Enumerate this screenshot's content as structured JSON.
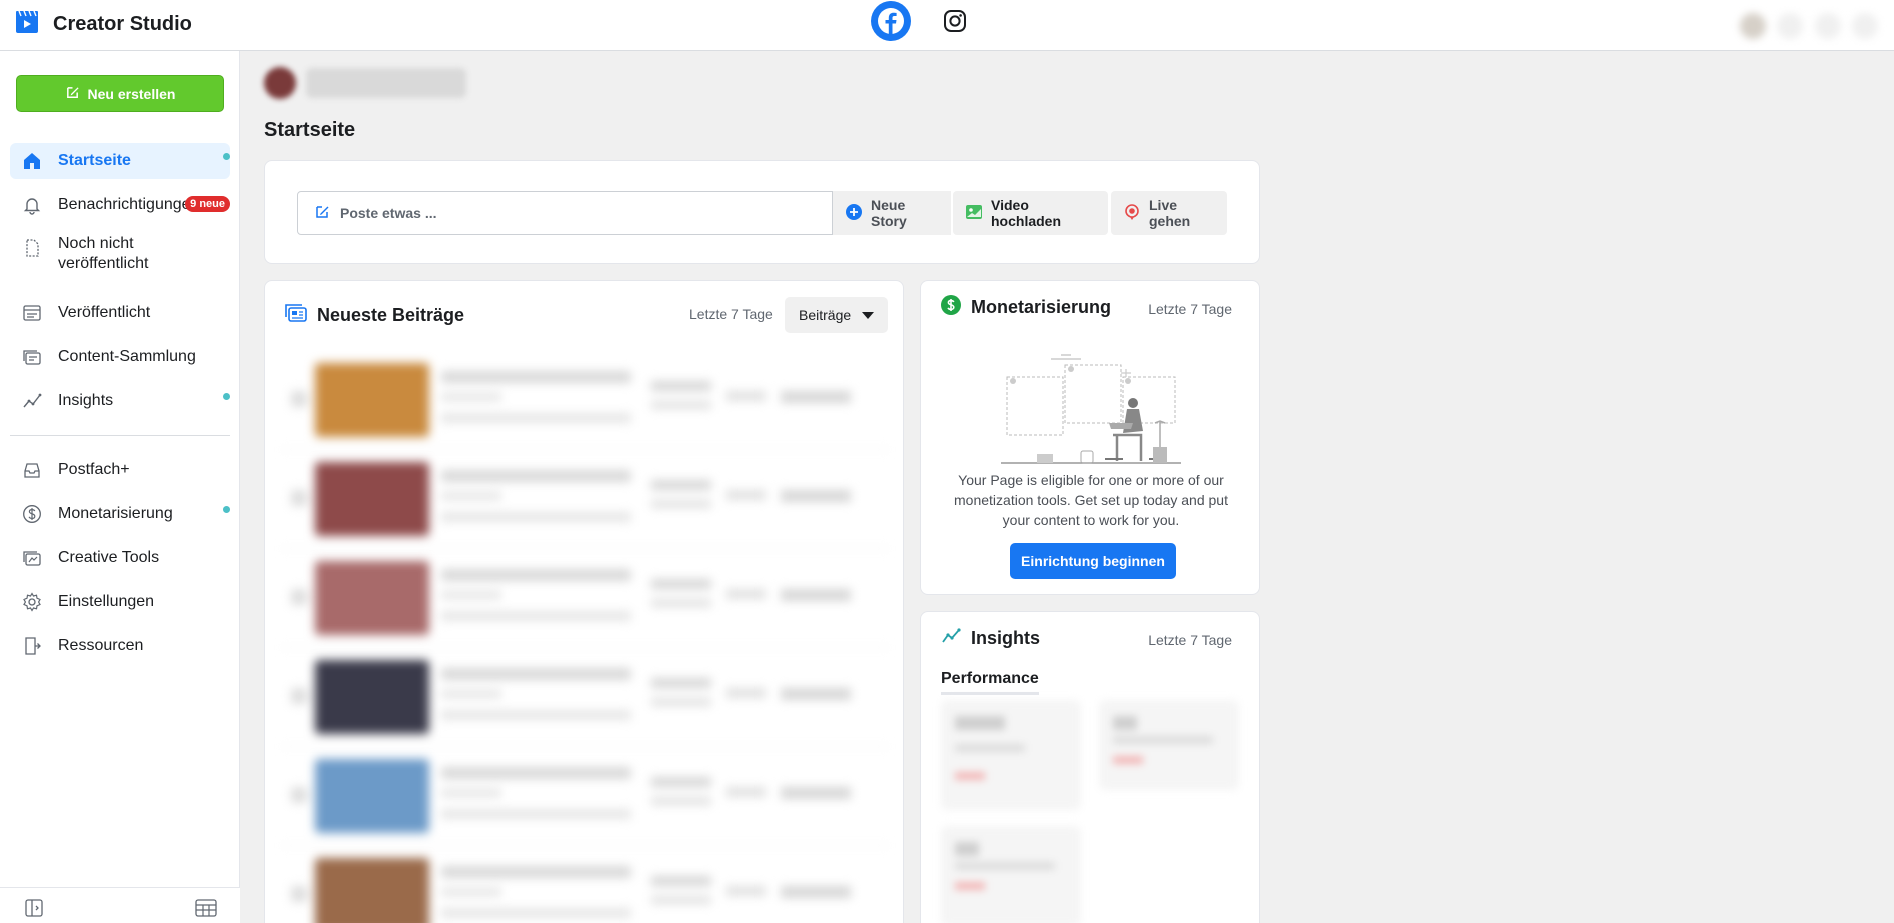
{
  "app": {
    "title": "Creator Studio",
    "icons": {
      "logo": "creator-studio-logo-icon",
      "facebook": "facebook-icon",
      "instagram": "instagram-icon"
    }
  },
  "sidebar": {
    "create_button": "Neu erstellen",
    "items": [
      {
        "label": "Startseite",
        "icon": "home-icon",
        "active": true,
        "dot": true
      },
      {
        "label": "Benachrichtigungen",
        "icon": "bell-icon",
        "badge": "9 neue"
      },
      {
        "label": "Noch nicht veröffentlicht",
        "icon": "draft-icon"
      },
      {
        "label": "Veröffentlicht",
        "icon": "published-icon"
      },
      {
        "label": "Content-Sammlung",
        "icon": "collection-icon"
      },
      {
        "label": "Insights",
        "icon": "insights-icon",
        "dot": true
      },
      {
        "label": "Postfach+",
        "icon": "inbox-icon"
      },
      {
        "label": "Monetarisierung",
        "icon": "dollar-icon",
        "dot": true
      },
      {
        "label": "Creative Tools",
        "icon": "creative-tools-icon"
      },
      {
        "label": "Einstellungen",
        "icon": "gear-icon"
      },
      {
        "label": "Ressourcen",
        "icon": "resources-icon"
      }
    ]
  },
  "main": {
    "page_title": "Startseite",
    "composer": {
      "placeholder": "Poste etwas ...",
      "new_story": "Neue Story",
      "upload_video": "Video hochladen",
      "go_live": "Live gehen"
    },
    "recent_posts": {
      "title": "Neueste Beiträge",
      "range": "Letzte 7 Tage",
      "filter": "Beiträge",
      "rows": [
        {
          "thumb_color": "#c98a3e"
        },
        {
          "thumb_color": "#8e4a4a"
        },
        {
          "thumb_color": "#a86a6a"
        },
        {
          "thumb_color": "#3a3a4a"
        },
        {
          "thumb_color": "#6c9ac8"
        },
        {
          "thumb_color": "#9a6a4a"
        }
      ]
    },
    "monetization": {
      "title": "Monetarisierung",
      "range": "Letzte 7 Tage",
      "text": "Your Page is eligible for one or more of our monetization tools. Get set up today and put your content to work for you.",
      "button": "Einrichtung beginnen"
    },
    "insights": {
      "title": "Insights",
      "range": "Letzte 7 Tage",
      "performance_label": "Performance"
    }
  },
  "colors": {
    "accent": "#1877f2",
    "create_button": "#62c92d",
    "badge": "#e02d2d",
    "status_dot": "#4cc0c7"
  }
}
